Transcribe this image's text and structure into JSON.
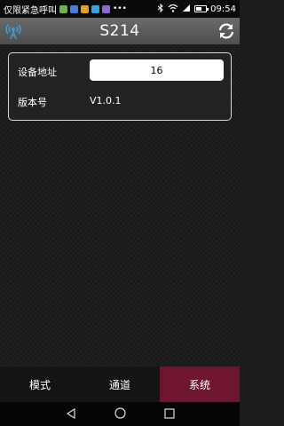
{
  "status_bar": {
    "carrier": "仅限紧急呼叫",
    "time": "09:54",
    "app_icon_colors": [
      "#6bb34a",
      "#4a7fd4",
      "#e0a030",
      "#3aa0e0",
      "#8a6ad0"
    ]
  },
  "header": {
    "title": "S214"
  },
  "settings": {
    "address_label": "设备地址",
    "address_value": "16",
    "version_label": "版本号",
    "version_value": "V1.0.1"
  },
  "tabs": [
    {
      "label": "模式",
      "active": false
    },
    {
      "label": "通道",
      "active": false
    },
    {
      "label": "系统",
      "active": true
    }
  ],
  "colors": {
    "header": "#5c5c5c",
    "active_tab": "#6e1530",
    "accent_icon": "#3e9ad6"
  }
}
